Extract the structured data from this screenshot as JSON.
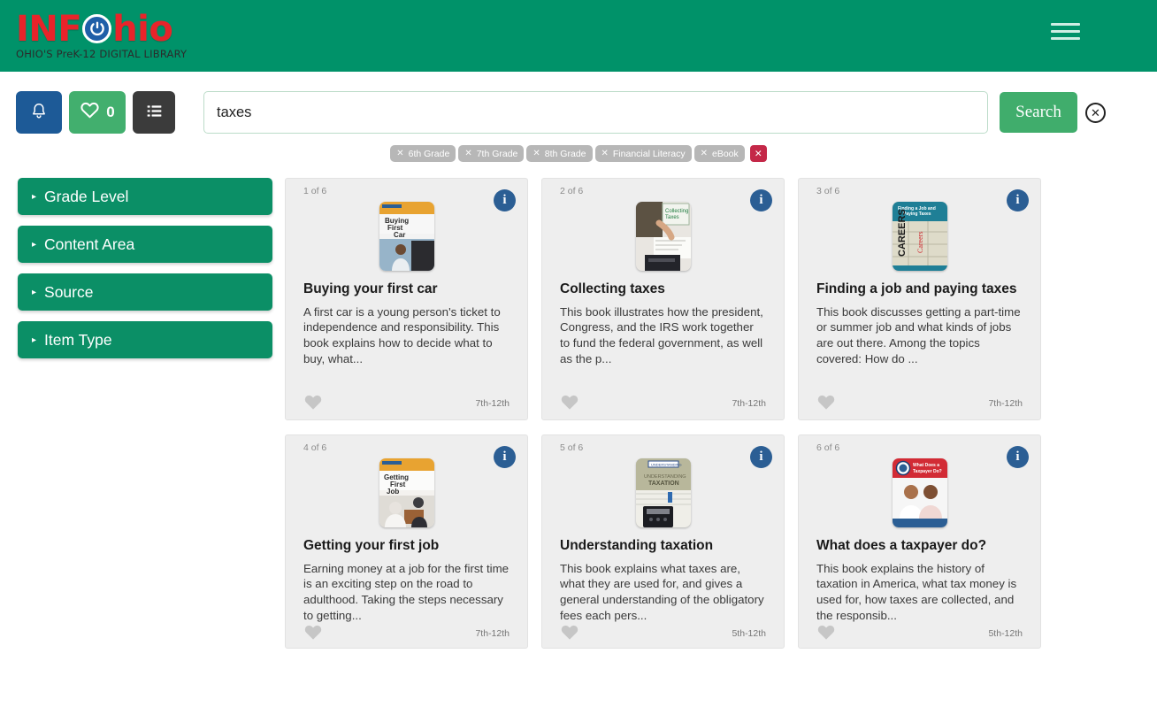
{
  "header": {
    "logo_text_1": "INF",
    "logo_text_2": "hio",
    "logo_icon": "power-icon",
    "tagline": "OHIO'S PreK-12 DIGITAL LIBRARY",
    "menu_icon": "hamburger-menu-icon",
    "background_color": "#009269"
  },
  "toolbar": {
    "bell_icon": "notification-bell-icon",
    "favorites_icon": "heart-icon",
    "favorites_count": "0",
    "list_icon": "list-view-icon",
    "search_value": "taxes",
    "search_placeholder": "",
    "search_label": "Search",
    "clear_icon": "clear-circle-x-icon",
    "bell_color": "#1d5a97",
    "fav_color": "#42af6e",
    "list_color": "#3b3b3b",
    "search_btn_color": "#40ad6c"
  },
  "chips": {
    "items": [
      {
        "label": "6th Grade"
      },
      {
        "label": "7th Grade"
      },
      {
        "label": "8th Grade"
      },
      {
        "label": "Financial Literacy"
      },
      {
        "label": "eBook"
      }
    ],
    "remove_icon": "x-icon",
    "clear_all_icon": "x-icon",
    "chip_color": "#b7b7b7",
    "clear_all_color": "#c42848"
  },
  "sidebar": {
    "facets": [
      {
        "label": "Grade Level",
        "caret": "▸"
      },
      {
        "label": "Content Area",
        "caret": "▸"
      },
      {
        "label": "Source",
        "caret": "▸"
      },
      {
        "label": "Item Type",
        "caret": "▸"
      }
    ],
    "facet_color": "#0b8f66"
  },
  "results": {
    "info_icon": "info-icon",
    "favorite_icon": "heart-icon",
    "cards": [
      {
        "index": "1 of 6",
        "title": "Buying your first car",
        "description": "A first car is a young person's ticket to independence and responsibility. This book explains how to decide what to buy, what...",
        "grade": "7th-12th",
        "cover": "buying-your-first-car-cover"
      },
      {
        "index": "2 of 6",
        "title": "Collecting taxes",
        "description": "This book illustrates how the president, Congress, and the IRS work together to fund the federal government, as well as the p...",
        "grade": "7th-12th",
        "cover": "collecting-taxes-cover"
      },
      {
        "index": "3 of 6",
        "title": "Finding a job and paying taxes",
        "description": "This book discusses getting a part-time or summer job and what kinds of jobs are out there. Among the topics covered: How do ...",
        "grade": "7th-12th",
        "cover": "finding-a-job-and-paying-taxes-cover"
      },
      {
        "index": "4 of 6",
        "title": "Getting your first job",
        "description": "Earning money at a job for the first time is an exciting step on the road to adulthood. Taking the steps necessary to getting...",
        "grade": "7th-12th",
        "cover": "getting-your-first-job-cover"
      },
      {
        "index": "5 of 6",
        "title": "Understanding taxation",
        "description": "This book explains what taxes are, what they are used for, and gives a general understanding of the obligatory fees each pers...",
        "grade": "5th-12th",
        "cover": "understanding-taxation-cover"
      },
      {
        "index": "6 of 6",
        "title": "What does a taxpayer do?",
        "description": "This book explains the history of taxation in America, what tax money is used for, how taxes are collected, and the responsib...",
        "grade": "5th-12th",
        "cover": "what-does-a-taxpayer-do-cover"
      }
    ]
  }
}
